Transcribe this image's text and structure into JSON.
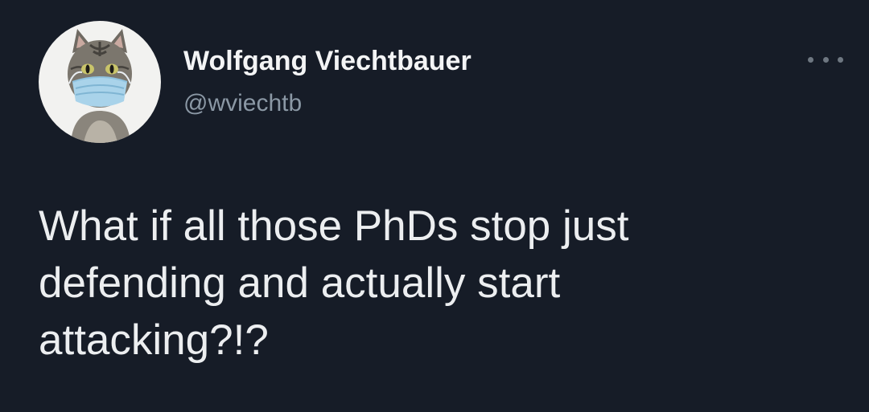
{
  "author": {
    "display_name": "Wolfgang Viechtbauer",
    "handle": "@wviechtb",
    "avatar_icon": "cat-with-face-mask-avatar"
  },
  "menu": {
    "icon": "more-options-icon"
  },
  "tweet": {
    "text": "What if all those PhDs stop just\ndefending and actually start\nattacking?!?"
  },
  "colors": {
    "background": "#161c27",
    "text_primary": "#e7e9ea",
    "text_secondary": "#8b98a5"
  }
}
